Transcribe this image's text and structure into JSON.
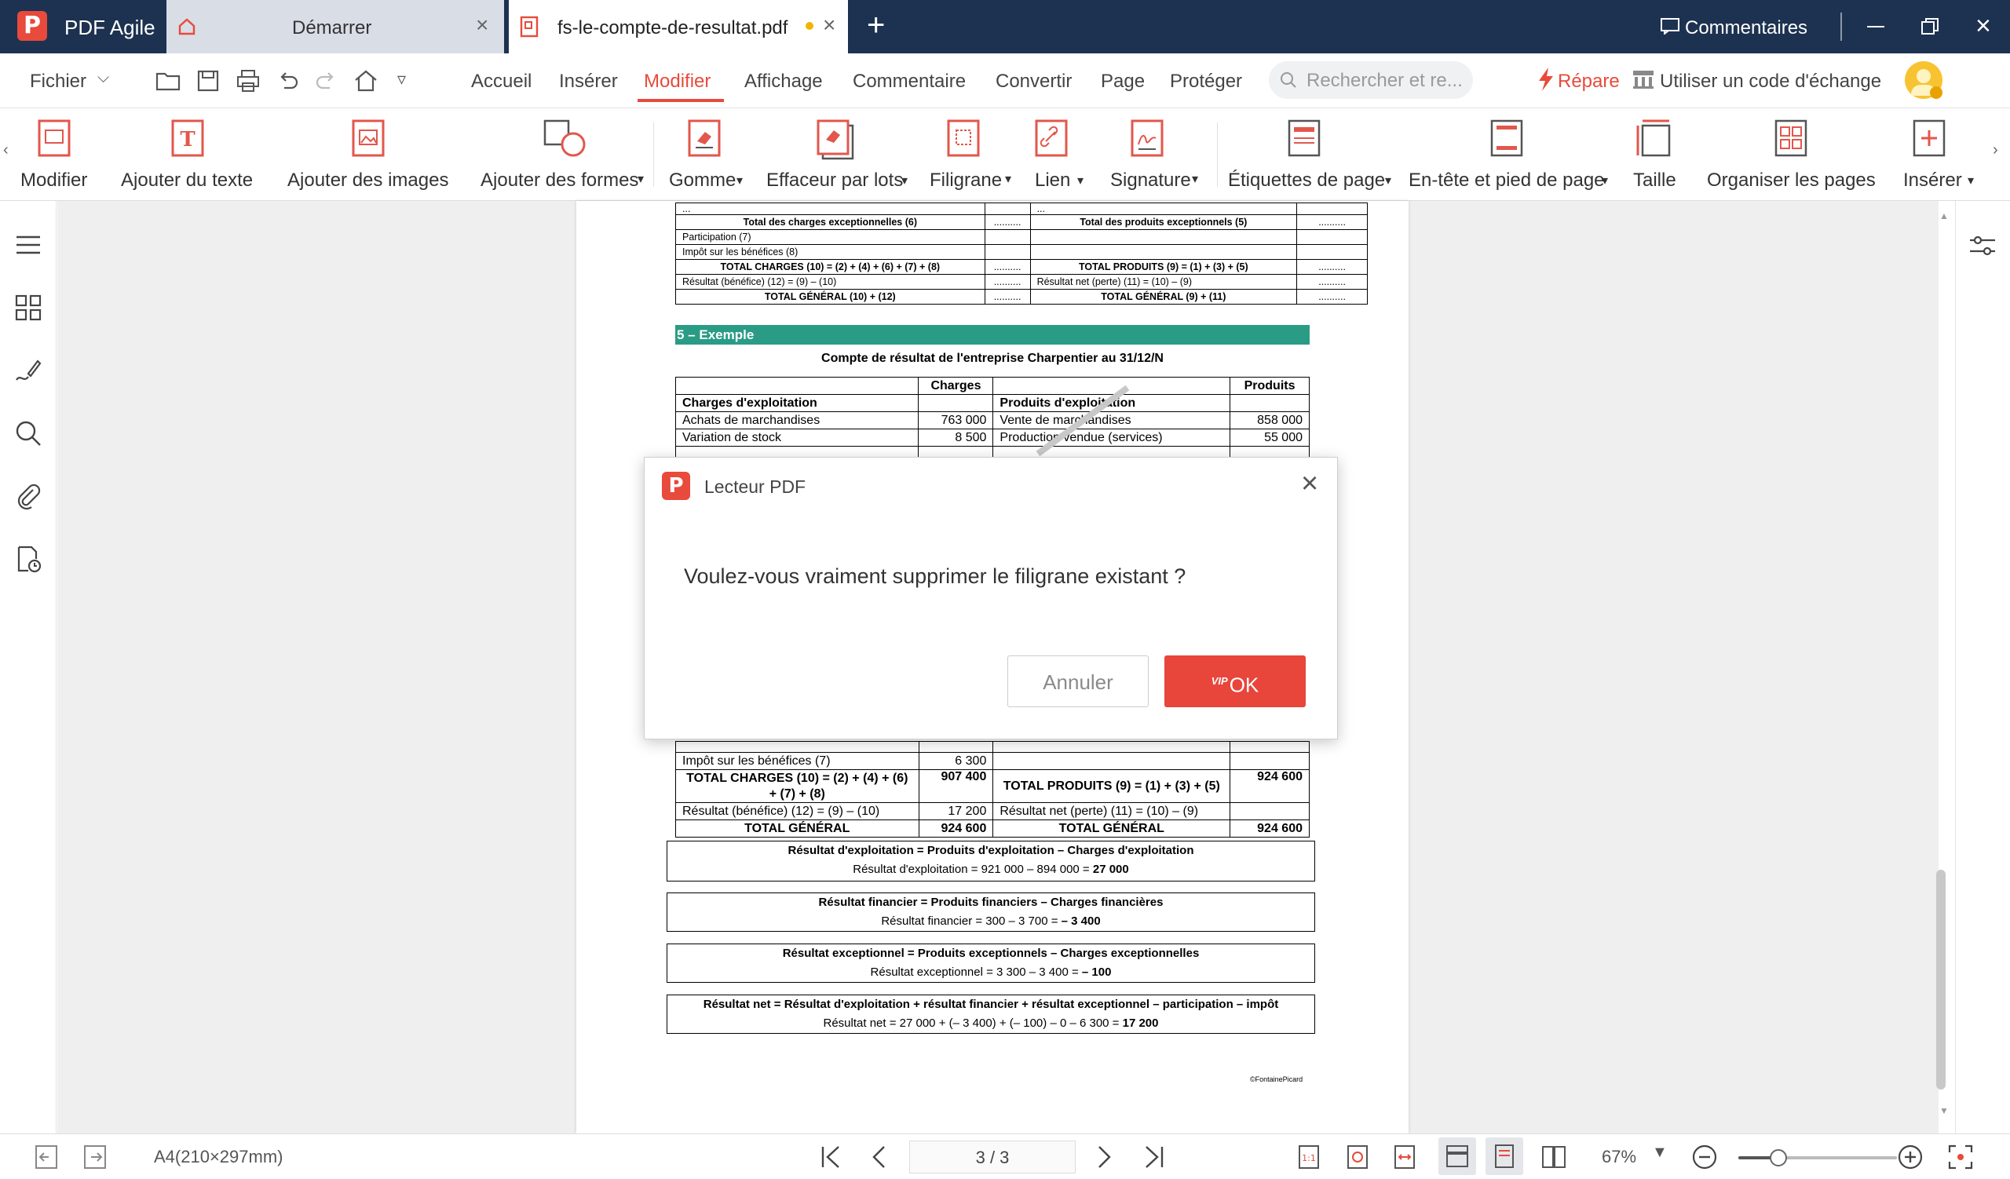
{
  "titlebar": {
    "app_name": "PDF Agile",
    "logo_letter": "P",
    "tabs": [
      {
        "label": "Démarrer"
      },
      {
        "label": "fs-le-compte-de-resultat.pdf"
      }
    ],
    "comments_label": "Commentaires"
  },
  "menubar": {
    "file_label": "Fichier",
    "items": [
      "Accueil",
      "Insérer",
      "Modifier",
      "Affichage",
      "Commentaire",
      "Convertir",
      "Page",
      "Protéger"
    ],
    "active_item": "Modifier",
    "search_placeholder": "Rechercher et re...",
    "repair_label": "Répare",
    "exchange_label": "Utiliser un code d'échange"
  },
  "ribbon": {
    "items": [
      {
        "label": "Modifier"
      },
      {
        "label": "Ajouter du texte"
      },
      {
        "label": "Ajouter des images"
      },
      {
        "label": "Ajouter des formes"
      },
      {
        "label": "Gomme"
      },
      {
        "label": "Effaceur par lots"
      },
      {
        "label": "Filigrane"
      },
      {
        "label": "Lien"
      },
      {
        "label": "Signature"
      },
      {
        "label": "Étiquettes de page"
      },
      {
        "label": "En-tête et pied de page"
      },
      {
        "label": "Taille"
      },
      {
        "label": "Organiser les pages"
      },
      {
        "label": "Insérer"
      }
    ]
  },
  "document": {
    "top_table": {
      "rows": [
        [
          "...",
          "",
          "...",
          ""
        ],
        [
          "Total des charges exceptionnelles (6)",
          "..........",
          "Total des produits exceptionnels (5)",
          ".........."
        ],
        [
          "Participation (7)",
          "",
          "",
          ""
        ],
        [
          "Impôt sur les bénéfices (8)",
          "",
          "",
          ""
        ],
        [
          "TOTAL CHARGES (10) = (2) + (4) + (6) + (7) + (8)",
          "..........",
          "TOTAL PRODUITS (9) = (1) + (3) + (5)",
          ".........."
        ],
        [
          "Résultat (bénéfice) (12) = (9) – (10)",
          "..........",
          "Résultat net (perte) (11) = (10) – (9)",
          ".........."
        ],
        [
          "TOTAL GÉNÉRAL (10) + (12)",
          "..........",
          "TOTAL GÉNÉRAL (9) + (11)",
          ".........."
        ]
      ]
    },
    "section_heading": "5 – Exemple",
    "example_title": "Compte de résultat de l'entreprise Charpentier au 31/12/N",
    "example_table": {
      "head_charges": "Charges",
      "head_produits": "Produits",
      "rows_top": [
        [
          "Charges d'exploitation",
          "",
          "Produits d'exploitation",
          ""
        ],
        [
          "Achats de marchandises",
          "763 000",
          "Vente de marchandises",
          "858 000"
        ],
        [
          "Variation de stock",
          "8 500",
          "Production vendue (services)",
          "55 000"
        ]
      ],
      "rows_bottom": [
        [
          "Impôt sur les bénéfices (7)",
          "6 300",
          "",
          ""
        ],
        [
          "TOTAL CHARGES (10) = (2) + (4) + (6) + (7) + (8)",
          "907 400",
          "TOTAL PRODUITS (9) = (1) + (3) + (5)",
          "924 600"
        ],
        [
          "Résultat (bénéfice) (12) = (9) – (10)",
          "17 200",
          "Résultat net (perte) (11) = (10) – (9)",
          ""
        ],
        [
          "TOTAL GÉNÉRAL",
          "924 600",
          "TOTAL GÉNÉRAL",
          "924 600"
        ]
      ]
    },
    "formulas": [
      {
        "title": "Résultat d'exploitation = Produits d'exploitation – Charges d'exploitation",
        "calc": "Résultat d'exploitation = 921 000 – 894 000 = ",
        "result": "27 000"
      },
      {
        "title": "Résultat financier = Produits financiers – Charges financières",
        "calc": "Résultat financier = 300 – 3 700 = ",
        "result": "– 3 400"
      },
      {
        "title": "Résultat exceptionnel = Produits exceptionnels – Charges exceptionnelles",
        "calc": "Résultat exceptionnel = 3 300 – 3 400 = ",
        "result": "– 100"
      },
      {
        "title": "Résultat net = Résultat d'exploitation + résultat financier + résultat exceptionnel – participation – impôt",
        "calc": "Résultat net = 27 000 + (– 3 400) + (– 100) – 0 – 6 300 = ",
        "result": "17 200"
      }
    ],
    "copyright": "©FontainePicard"
  },
  "dialog": {
    "title": "Lecteur PDF",
    "message": "Voulez-vous vraiment supprimer le filigrane existant ?",
    "cancel_label": "Annuler",
    "ok_label": "OK",
    "vip_badge": "VIP"
  },
  "statusbar": {
    "page_size": "A4(210×297mm)",
    "page_indicator": "3 / 3",
    "zoom": "67%",
    "zoom_fraction": 0.25
  },
  "colors": {
    "titlebar_bg": "#1d3250",
    "accent_red": "#e84a3b",
    "section_teal": "#2a9c86",
    "ok_button": "#e8453b"
  }
}
